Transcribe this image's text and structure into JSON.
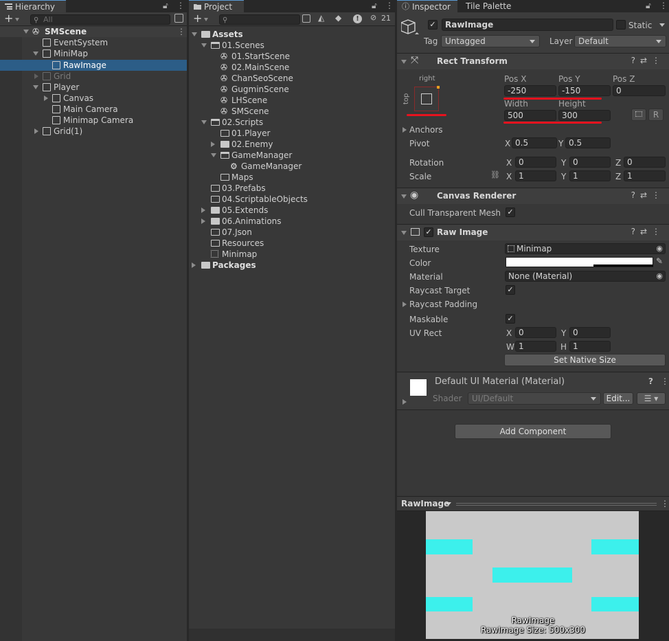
{
  "hierarchy": {
    "tab_label": "Hierarchy",
    "search_placeholder": "All",
    "scene": "SMScene",
    "items": [
      "EventSystem",
      "MiniMap",
      "RawImage",
      "Grid",
      "Player",
      "Canvas",
      "Main Camera",
      "Minimap Camera",
      "Grid(1)"
    ]
  },
  "project": {
    "tab_label": "Project",
    "hidden_count": "21",
    "assets_label": "Assets",
    "tree": [
      "01.Scenes",
      "01.StartScene",
      "02.MainScene",
      "ChanSeoScene",
      "GugminScene",
      "LHScene",
      "SMScene",
      "02.Scripts",
      "01.Player",
      "02.Enemy",
      "GameManager",
      "GameManager",
      "Maps",
      "03.Prefabs",
      "04.ScriptableObjects",
      "05.Extends",
      "06.Animations",
      "07.Json",
      "Resources",
      "Minimap"
    ],
    "packages_label": "Packages"
  },
  "inspector": {
    "tab_label": "Inspector",
    "tab2_label": "Tile Palette",
    "object_name": "RawImage",
    "static_label": "Static",
    "tag_label": "Tag",
    "tag_value": "Untagged",
    "layer_label": "Layer",
    "layer_value": "Default",
    "rect": {
      "title": "Rect Transform",
      "anchor_h": "right",
      "anchor_v": "top",
      "posx_label": "Pos X",
      "posx": "-250",
      "posy_label": "Pos Y",
      "posy": "-150",
      "posz_label": "Pos Z",
      "posz": "0",
      "width_label": "Width",
      "width": "500",
      "height_label": "Height",
      "height": "300",
      "r_label": "R",
      "anchors_label": "Anchors",
      "pivot_label": "Pivot",
      "pivot_x": "0.5",
      "pivot_y": "0.5",
      "rotation_label": "Rotation",
      "rot_x": "0",
      "rot_y": "0",
      "rot_z": "0",
      "scale_label": "Scale",
      "scale_x": "1",
      "scale_y": "1",
      "scale_z": "1",
      "x": "X",
      "y": "Y",
      "z": "Z"
    },
    "canvas_renderer": {
      "title": "Canvas Renderer",
      "cull_label": "Cull Transparent Mesh"
    },
    "raw_image": {
      "title": "Raw Image",
      "texture_label": "Texture",
      "texture_value": "Minimap",
      "color_label": "Color",
      "material_label": "Material",
      "material_value": "None (Material)",
      "raycast_target_label": "Raycast Target",
      "raycast_padding_label": "Raycast Padding",
      "maskable_label": "Maskable",
      "uvrect_label": "UV Rect",
      "uv_x": "0",
      "uv_y": "0",
      "uv_w": "1",
      "uv_h": "1",
      "w": "W",
      "h": "H",
      "native_size_button": "Set Native Size"
    },
    "material": {
      "title": "Default UI Material (Material)",
      "shader_label": "Shader",
      "shader_value": "UI/Default",
      "edit_button": "Edit..."
    },
    "add_component_button": "Add Component",
    "preview": {
      "title": "RawImage",
      "caption1": "RawImage",
      "caption2": "RawImage Size: 500x300",
      "bg_color": "#c9c9c9",
      "rect_color": "#3cf0ec"
    }
  },
  "colors": {
    "selection": "#2c5d87",
    "highlight_red": "#e8121e"
  }
}
